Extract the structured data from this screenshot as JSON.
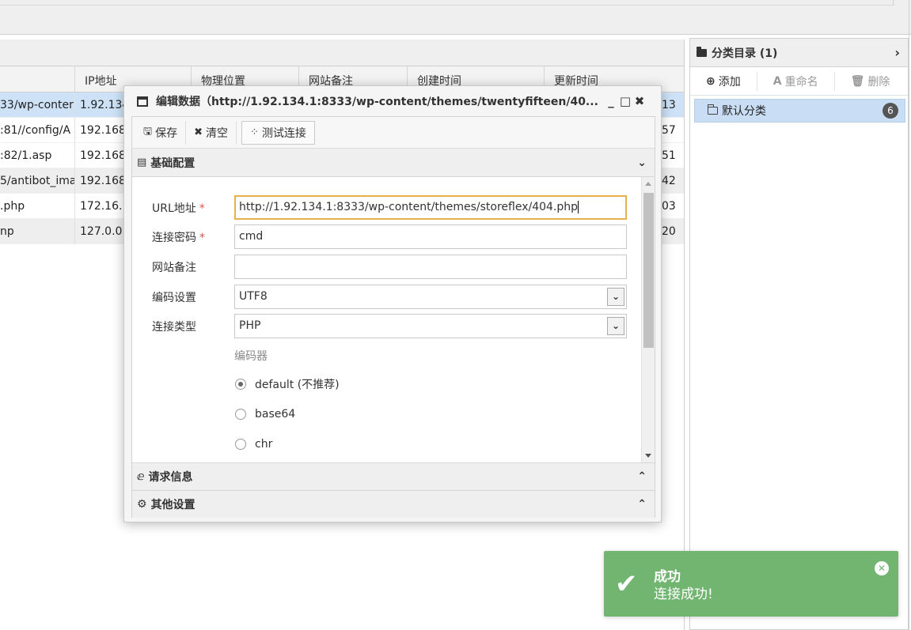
{
  "grid": {
    "headers": [
      "IP地址",
      "物理位置",
      "网站备注",
      "创建时间",
      "更新时间"
    ],
    "rows": [
      {
        "url": "33/wp-conter",
        "ip": "1.92.134",
        "time": "13"
      },
      {
        "url": ":81//config/A",
        "ip": "192.168",
        "time": "57"
      },
      {
        "url": ":82/1.asp",
        "ip": "192.168",
        "time": "51"
      },
      {
        "url": "5/antibot_ima",
        "ip": "192.168",
        "time": "42"
      },
      {
        "url": ".php",
        "ip": "172.16.",
        "time": "03"
      },
      {
        "url": "np",
        "ip": "127.0.0",
        "time": "20"
      }
    ]
  },
  "categories": {
    "title": "分类目录 (1)",
    "toolbar": {
      "add": "添加",
      "rename": "重命名",
      "delete": "删除"
    },
    "items": [
      {
        "label": "默认分类",
        "count": "6"
      }
    ]
  },
  "dialog": {
    "title": "编辑数据（http://1.92.134.1:8333/wp-content/themes/twentyfifteen/40...",
    "toolbar": {
      "save": "保存",
      "clear": "清空",
      "test": "测试连接"
    },
    "section_basic": "基础配置",
    "fields": {
      "url_label": "URL地址",
      "url_value": "http://1.92.134.1:8333/wp-content/themes/storeflex/404.php",
      "password_label": "连接密码",
      "password_value": "cmd",
      "note_label": "网站备注",
      "note_value": "",
      "encoding_label": "编码设置",
      "encoding_value": "UTF8",
      "type_label": "连接类型",
      "type_value": "PHP",
      "required_mark": "*"
    },
    "encoder": {
      "title": "编码器",
      "options": [
        "default (不推荐)",
        "base64",
        "chr"
      ],
      "selected": "default (不推荐)"
    },
    "section_request": "请求信息",
    "section_other": "其他设置"
  },
  "toast": {
    "title": "成功",
    "message": "连接成功!",
    "color": "#72b571"
  }
}
